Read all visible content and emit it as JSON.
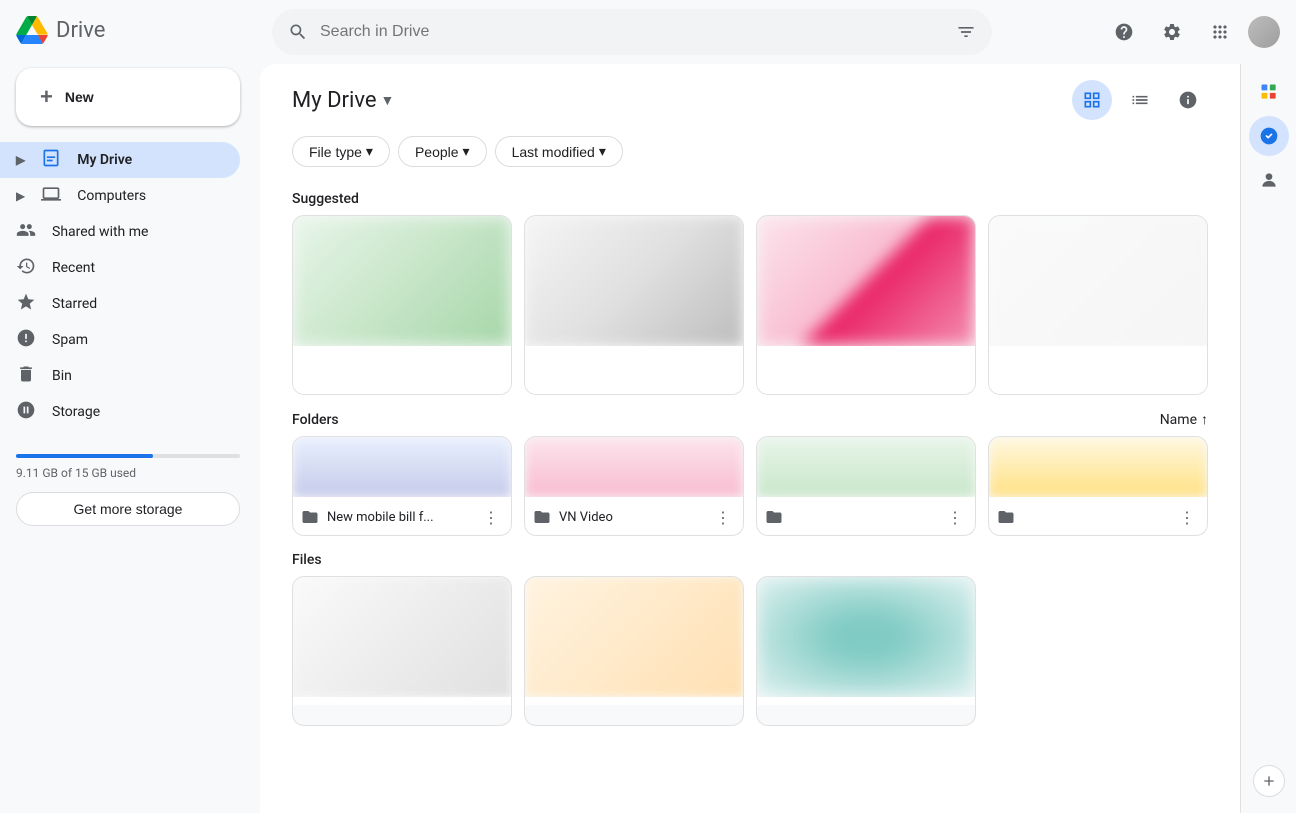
{
  "app": {
    "logo_text": "Drive",
    "search_placeholder": "Search in Drive"
  },
  "sidebar": {
    "new_button_label": "New",
    "items": [
      {
        "id": "my-drive",
        "label": "My Drive",
        "icon": "🗂️",
        "active": true
      },
      {
        "id": "computers",
        "label": "Computers",
        "icon": "💻",
        "active": false
      },
      {
        "id": "shared-with-me",
        "label": "Shared with me",
        "icon": "👥",
        "active": false
      },
      {
        "id": "recent",
        "label": "Recent",
        "icon": "🕐",
        "active": false
      },
      {
        "id": "starred",
        "label": "Starred",
        "icon": "⭐",
        "active": false
      },
      {
        "id": "spam",
        "label": "Spam",
        "icon": "🕐",
        "active": false
      },
      {
        "id": "bin",
        "label": "Bin",
        "icon": "🗑️",
        "active": false
      },
      {
        "id": "storage",
        "label": "Storage",
        "icon": "☁️",
        "active": false
      }
    ],
    "storage": {
      "used_text": "9.11 GB of 15 GB used",
      "get_more_label": "Get more storage",
      "percent": 61
    }
  },
  "header": {
    "title": "My Drive",
    "chevron": "▼"
  },
  "filters": {
    "file_type": {
      "label": "File type",
      "chevron": "▾"
    },
    "people": {
      "label": "People",
      "chevron": "▾"
    },
    "last_modified": {
      "label": "Last modified",
      "chevron": "▾"
    }
  },
  "sections": {
    "suggested": "Suggested",
    "folders": "Folders",
    "files": "Files",
    "sort_name": "Name",
    "sort_arrow": "↑"
  },
  "folders": [
    {
      "name": "New mobile bill f..."
    },
    {
      "name": "VN Video"
    },
    {
      "name": ""
    },
    {
      "name": ""
    }
  ],
  "topbar_icons": {
    "help": "?",
    "settings": "⚙",
    "apps": "⠿",
    "filter": "⚙"
  },
  "right_sidebar": {
    "icons": [
      "📅",
      "✅",
      "👤"
    ],
    "add_icon": "+"
  }
}
